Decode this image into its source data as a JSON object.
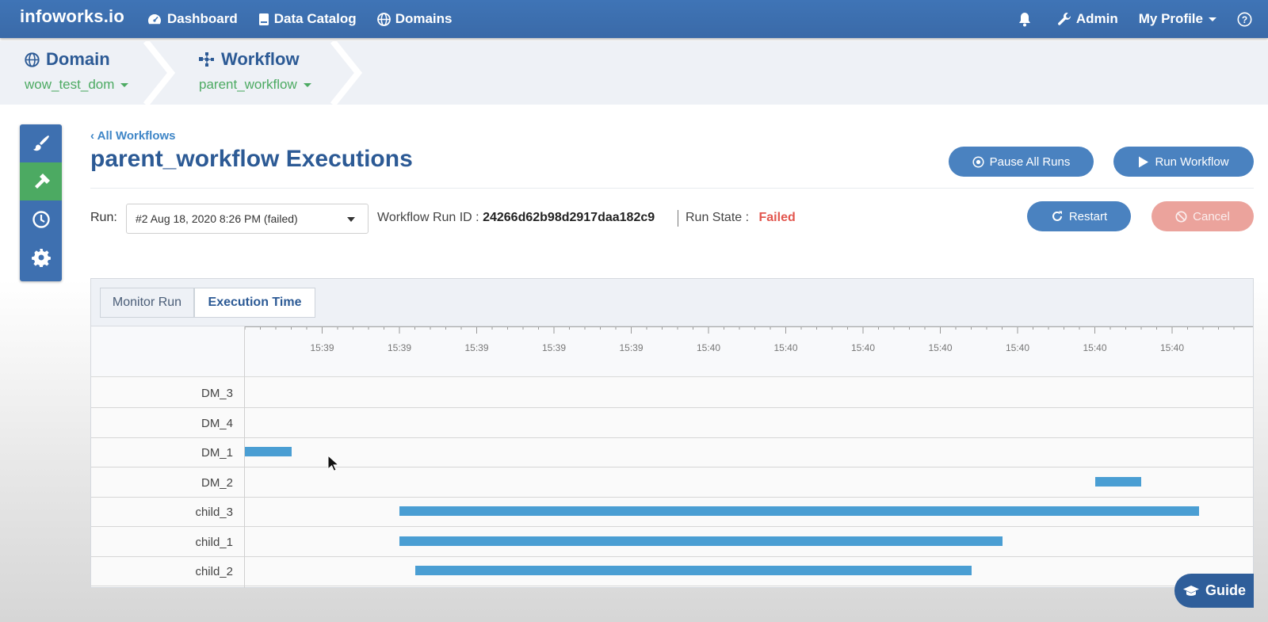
{
  "topbar": {
    "brand": "infoworks.io",
    "nav": [
      {
        "label": "Dashboard",
        "icon": "dashboard-icon"
      },
      {
        "label": "Data Catalog",
        "icon": "book-icon"
      },
      {
        "label": "Domains",
        "icon": "globe-icon"
      }
    ],
    "right": {
      "admin": "Admin",
      "profile": "My Profile",
      "bell_icon": "bell-icon",
      "help_icon": "help-icon"
    },
    "color": "#3f74b6"
  },
  "breadcrumb": {
    "domain": {
      "title": "Domain",
      "value": "wow_test_dom"
    },
    "workflow": {
      "title": "Workflow",
      "value": "parent_workflow"
    }
  },
  "rail": {
    "items": [
      "brush-icon",
      "hammer-icon",
      "clock-icon",
      "gear-icon"
    ],
    "active_index": 1
  },
  "header": {
    "back": "All Workflows",
    "title": "parent_workflow Executions",
    "pause_all": "Pause All Runs",
    "run_workflow": "Run Workflow",
    "restart": "Restart",
    "cancel": "Cancel"
  },
  "run": {
    "label": "Run:",
    "selected": "#2 Aug 18, 2020 8:26 PM (failed)",
    "run_id_label": "Workflow Run ID :",
    "run_id": "24266d62b98d2917daa182c9",
    "state_label": "Run State :",
    "state": "Failed",
    "state_color": "#e2564e"
  },
  "tabs": {
    "monitor": "Monitor Run",
    "execution": "Execution Time",
    "active": "Execution Time"
  },
  "chart_data": {
    "type": "bar",
    "orientation": "horizontal-gantt",
    "tick_labels": [
      "15:39",
      "15:39",
      "15:39",
      "15:39",
      "15:39",
      "15:40",
      "15:40",
      "15:40",
      "15:40",
      "15:40",
      "15:40",
      "15:40"
    ],
    "rows": [
      {
        "name": "DM_3",
        "start": null,
        "end": null
      },
      {
        "name": "DM_4",
        "start": null,
        "end": null
      },
      {
        "name": "DM_1",
        "start": 0.0,
        "end": 0.6
      },
      {
        "name": "DM_2",
        "start": 11.0,
        "end": 11.6
      },
      {
        "name": "child_3",
        "start": 2.0,
        "end": 12.35
      },
      {
        "name": "child_1",
        "start": 2.0,
        "end": 9.8
      },
      {
        "name": "child_2",
        "start": 2.2,
        "end": 9.4
      }
    ],
    "bar_color": "#4a9ed3",
    "grid": true
  },
  "guide": {
    "label": "Guide"
  }
}
